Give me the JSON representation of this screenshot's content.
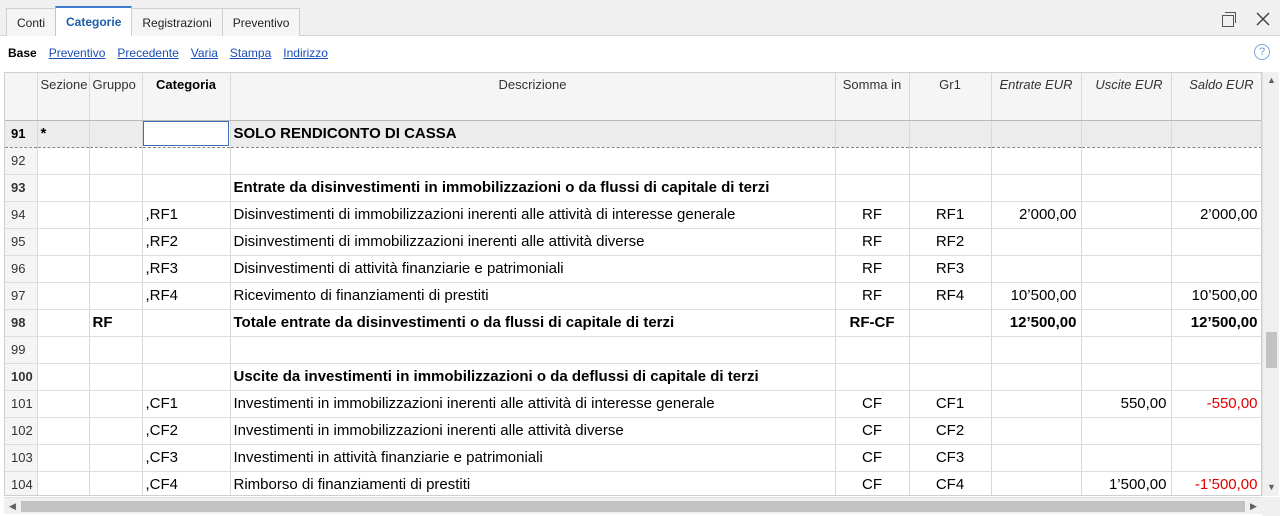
{
  "tabs": [
    "Conti",
    "Categorie",
    "Registrazioni",
    "Preventivo"
  ],
  "active_tab": "Categorie",
  "subnav": [
    "Base",
    "Preventivo",
    "Precedente",
    "Varia",
    "Stampa",
    "Indirizzo"
  ],
  "columns": [
    "Sezione",
    "Gruppo",
    "Categoria",
    "Descrizione",
    "Somma in",
    "Gr1",
    "Entrate EUR",
    "Uscite EUR",
    "Saldo EUR"
  ],
  "rows": [
    {
      "num": "91",
      "sezione": "*",
      "gruppo": "",
      "categoria": "",
      "descrizione": "SOLO RENDICONTO DI CASSA",
      "somma_in": "",
      "gr1": "",
      "entrate": "",
      "uscite": "",
      "saldo": "",
      "bold": true,
      "current": true
    },
    {
      "num": "92",
      "sezione": "",
      "gruppo": "",
      "categoria": "",
      "descrizione": "",
      "somma_in": "",
      "gr1": "",
      "entrate": "",
      "uscite": "",
      "saldo": ""
    },
    {
      "num": "93",
      "sezione": "",
      "gruppo": "",
      "categoria": "",
      "descrizione": "Entrate da disinvestimenti in immobilizzazioni o da flussi di capitale di terzi",
      "somma_in": "",
      "gr1": "",
      "entrate": "",
      "uscite": "",
      "saldo": "",
      "bold": true
    },
    {
      "num": "94",
      "sezione": "",
      "gruppo": "",
      "categoria": ",RF1",
      "descrizione": "Disinvestimenti di immobilizzazioni inerenti alle attività di interesse generale",
      "somma_in": "RF",
      "gr1": "RF1",
      "entrate": "2’000,00",
      "uscite": "",
      "saldo": "2’000,00"
    },
    {
      "num": "95",
      "sezione": "",
      "gruppo": "",
      "categoria": ",RF2",
      "descrizione": "Disinvestimenti di immobilizzazioni inerenti alle attività diverse",
      "somma_in": "RF",
      "gr1": "RF2",
      "entrate": "",
      "uscite": "",
      "saldo": ""
    },
    {
      "num": "96",
      "sezione": "",
      "gruppo": "",
      "categoria": ",RF3",
      "descrizione": "Disinvestimenti di attività finanziarie e patrimoniali",
      "somma_in": "RF",
      "gr1": "RF3",
      "entrate": "",
      "uscite": "",
      "saldo": ""
    },
    {
      "num": "97",
      "sezione": "",
      "gruppo": "",
      "categoria": ",RF4",
      "descrizione": "Ricevimento di finanziamenti di prestiti",
      "somma_in": "RF",
      "gr1": "RF4",
      "entrate": "10’500,00",
      "uscite": "",
      "saldo": "10’500,00"
    },
    {
      "num": "98",
      "sezione": "",
      "gruppo": "RF",
      "categoria": "",
      "descrizione": "Totale entrate da disinvestimenti o da flussi di capitale di terzi",
      "somma_in": "RF-CF",
      "gr1": "",
      "entrate": "12’500,00",
      "uscite": "",
      "saldo": "12’500,00",
      "bold": true
    },
    {
      "num": "99",
      "sezione": "",
      "gruppo": "",
      "categoria": "",
      "descrizione": "",
      "somma_in": "",
      "gr1": "",
      "entrate": "",
      "uscite": "",
      "saldo": ""
    },
    {
      "num": "100",
      "sezione": "",
      "gruppo": "",
      "categoria": "",
      "descrizione": "Uscite da investimenti in immobilizzazioni o da deflussi di capitale di terzi",
      "somma_in": "",
      "gr1": "",
      "entrate": "",
      "uscite": "",
      "saldo": "",
      "bold": true
    },
    {
      "num": "101",
      "sezione": "",
      "gruppo": "",
      "categoria": ",CF1",
      "descrizione": "Investimenti in immobilizzazioni inerenti alle attività di interesse generale",
      "somma_in": "CF",
      "gr1": "CF1",
      "entrate": "",
      "uscite": "550,00",
      "saldo": "-550,00",
      "neg": true
    },
    {
      "num": "102",
      "sezione": "",
      "gruppo": "",
      "categoria": ",CF2",
      "descrizione": "Investimenti in immobilizzazioni inerenti alle attività diverse",
      "somma_in": "CF",
      "gr1": "CF2",
      "entrate": "",
      "uscite": "",
      "saldo": ""
    },
    {
      "num": "103",
      "sezione": "",
      "gruppo": "",
      "categoria": ",CF3",
      "descrizione": "Investimenti in attività finanziarie e patrimoniali",
      "somma_in": "CF",
      "gr1": "CF3",
      "entrate": "",
      "uscite": "",
      "saldo": ""
    },
    {
      "num": "104",
      "sezione": "",
      "gruppo": "",
      "categoria": ",CF4",
      "descrizione": "Rimborso di finanziamenti di prestiti",
      "somma_in": "CF",
      "gr1": "CF4",
      "entrate": "",
      "uscite": "1’500,00",
      "saldo": "-1’500,00",
      "neg": true
    }
  ],
  "colors": {
    "accent": "#3d7bd1",
    "link": "#1a4db3",
    "negative": "#e00000"
  },
  "icons": [
    "restore-window-icon",
    "close-icon",
    "help-icon",
    "scroll-up-icon",
    "scroll-down-icon",
    "scroll-left-icon",
    "scroll-right-icon"
  ]
}
